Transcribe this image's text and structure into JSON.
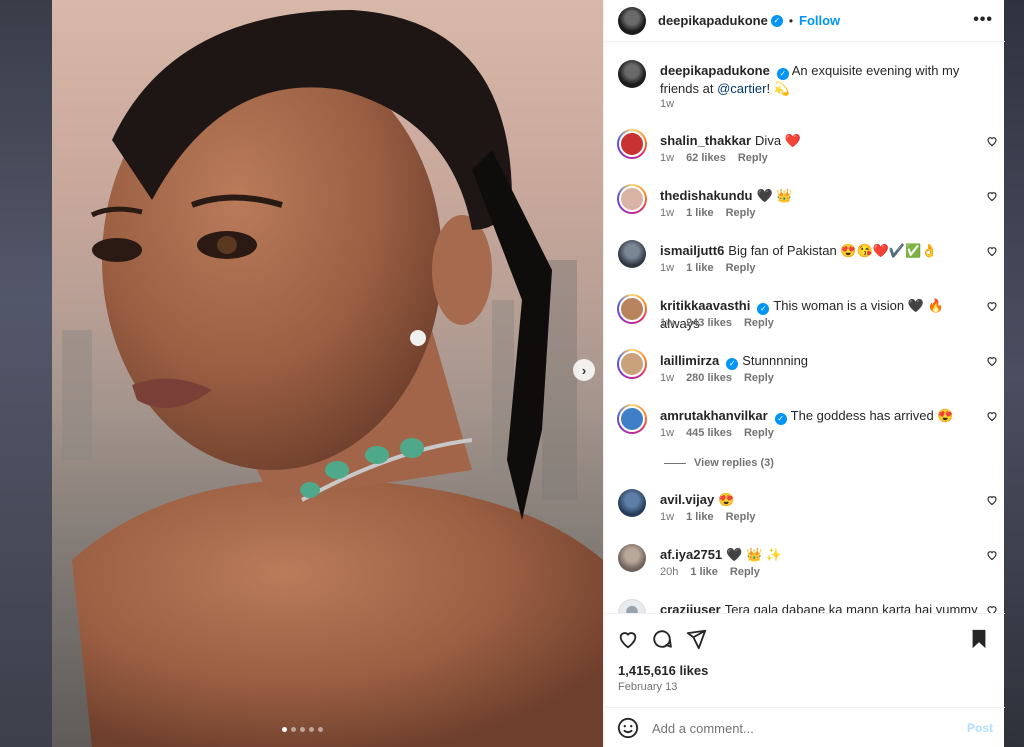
{
  "post": {
    "author": "deepikapadukone",
    "follow_label": "Follow",
    "separator": "•",
    "more_icon": "•••",
    "caption_text": "An exquisite evening with my friends at",
    "caption_mention": "@cartier",
    "caption_end": "! 💫",
    "caption_time": "1w",
    "likes": "1,415,616 likes",
    "date": "February 13",
    "next_icon": "›"
  },
  "comments": [
    {
      "user": "shalin_thakkar",
      "text": "Diva ❤️",
      "time": "1w",
      "likes": "62 likes",
      "reply": "Reply",
      "verified": false
    },
    {
      "user": "thedishakundu",
      "text": "🖤 👑",
      "time": "1w",
      "likes": "1 like",
      "reply": "Reply",
      "verified": false
    },
    {
      "user": "ismailjutt6",
      "text": "Big fan of Pakistan 😍😘❤️✔️✅👌",
      "time": "1w",
      "likes": "1 like",
      "reply": "Reply",
      "verified": false
    },
    {
      "user": "kritikkaavasthi",
      "text": "This woman is a vision 🖤 🔥 always",
      "time": "1w",
      "likes": "243 likes",
      "reply": "Reply",
      "verified": true
    },
    {
      "user": "laillimirza",
      "text": "Stunnnning",
      "time": "1w",
      "likes": "280 likes",
      "reply": "Reply",
      "verified": true
    },
    {
      "user": "amrutakhanvilkar",
      "text": "The goddess has arrived 😍",
      "time": "1w",
      "likes": "445 likes",
      "reply": "Reply",
      "verified": true
    },
    {
      "user": "avil.vijay",
      "text": "😍",
      "time": "1w",
      "likes": "1 like",
      "reply": "Reply",
      "verified": false
    },
    {
      "user": "af.iya2751",
      "text": "🖤 👑 ✨",
      "time": "20h",
      "likes": "1 like",
      "reply": "Reply",
      "verified": false
    },
    {
      "user": "craziiuser",
      "text": "Tera gala dabane ka mann karta hai yummy yummy",
      "time": "",
      "likes": "",
      "reply": "",
      "verified": false
    }
  ],
  "view_replies": "View replies (3)",
  "add_comment": {
    "placeholder": "Add a comment...",
    "post_label": "Post"
  },
  "colors": {
    "accent": "#0095f6",
    "like": "#ed4956",
    "text": "#262626",
    "muted": "#737373"
  },
  "icons": [
    "heart-icon",
    "comment-icon",
    "share-icon",
    "bookmark-icon",
    "emoji-icon",
    "verified-icon",
    "more-icon",
    "chevron-right-icon"
  ]
}
